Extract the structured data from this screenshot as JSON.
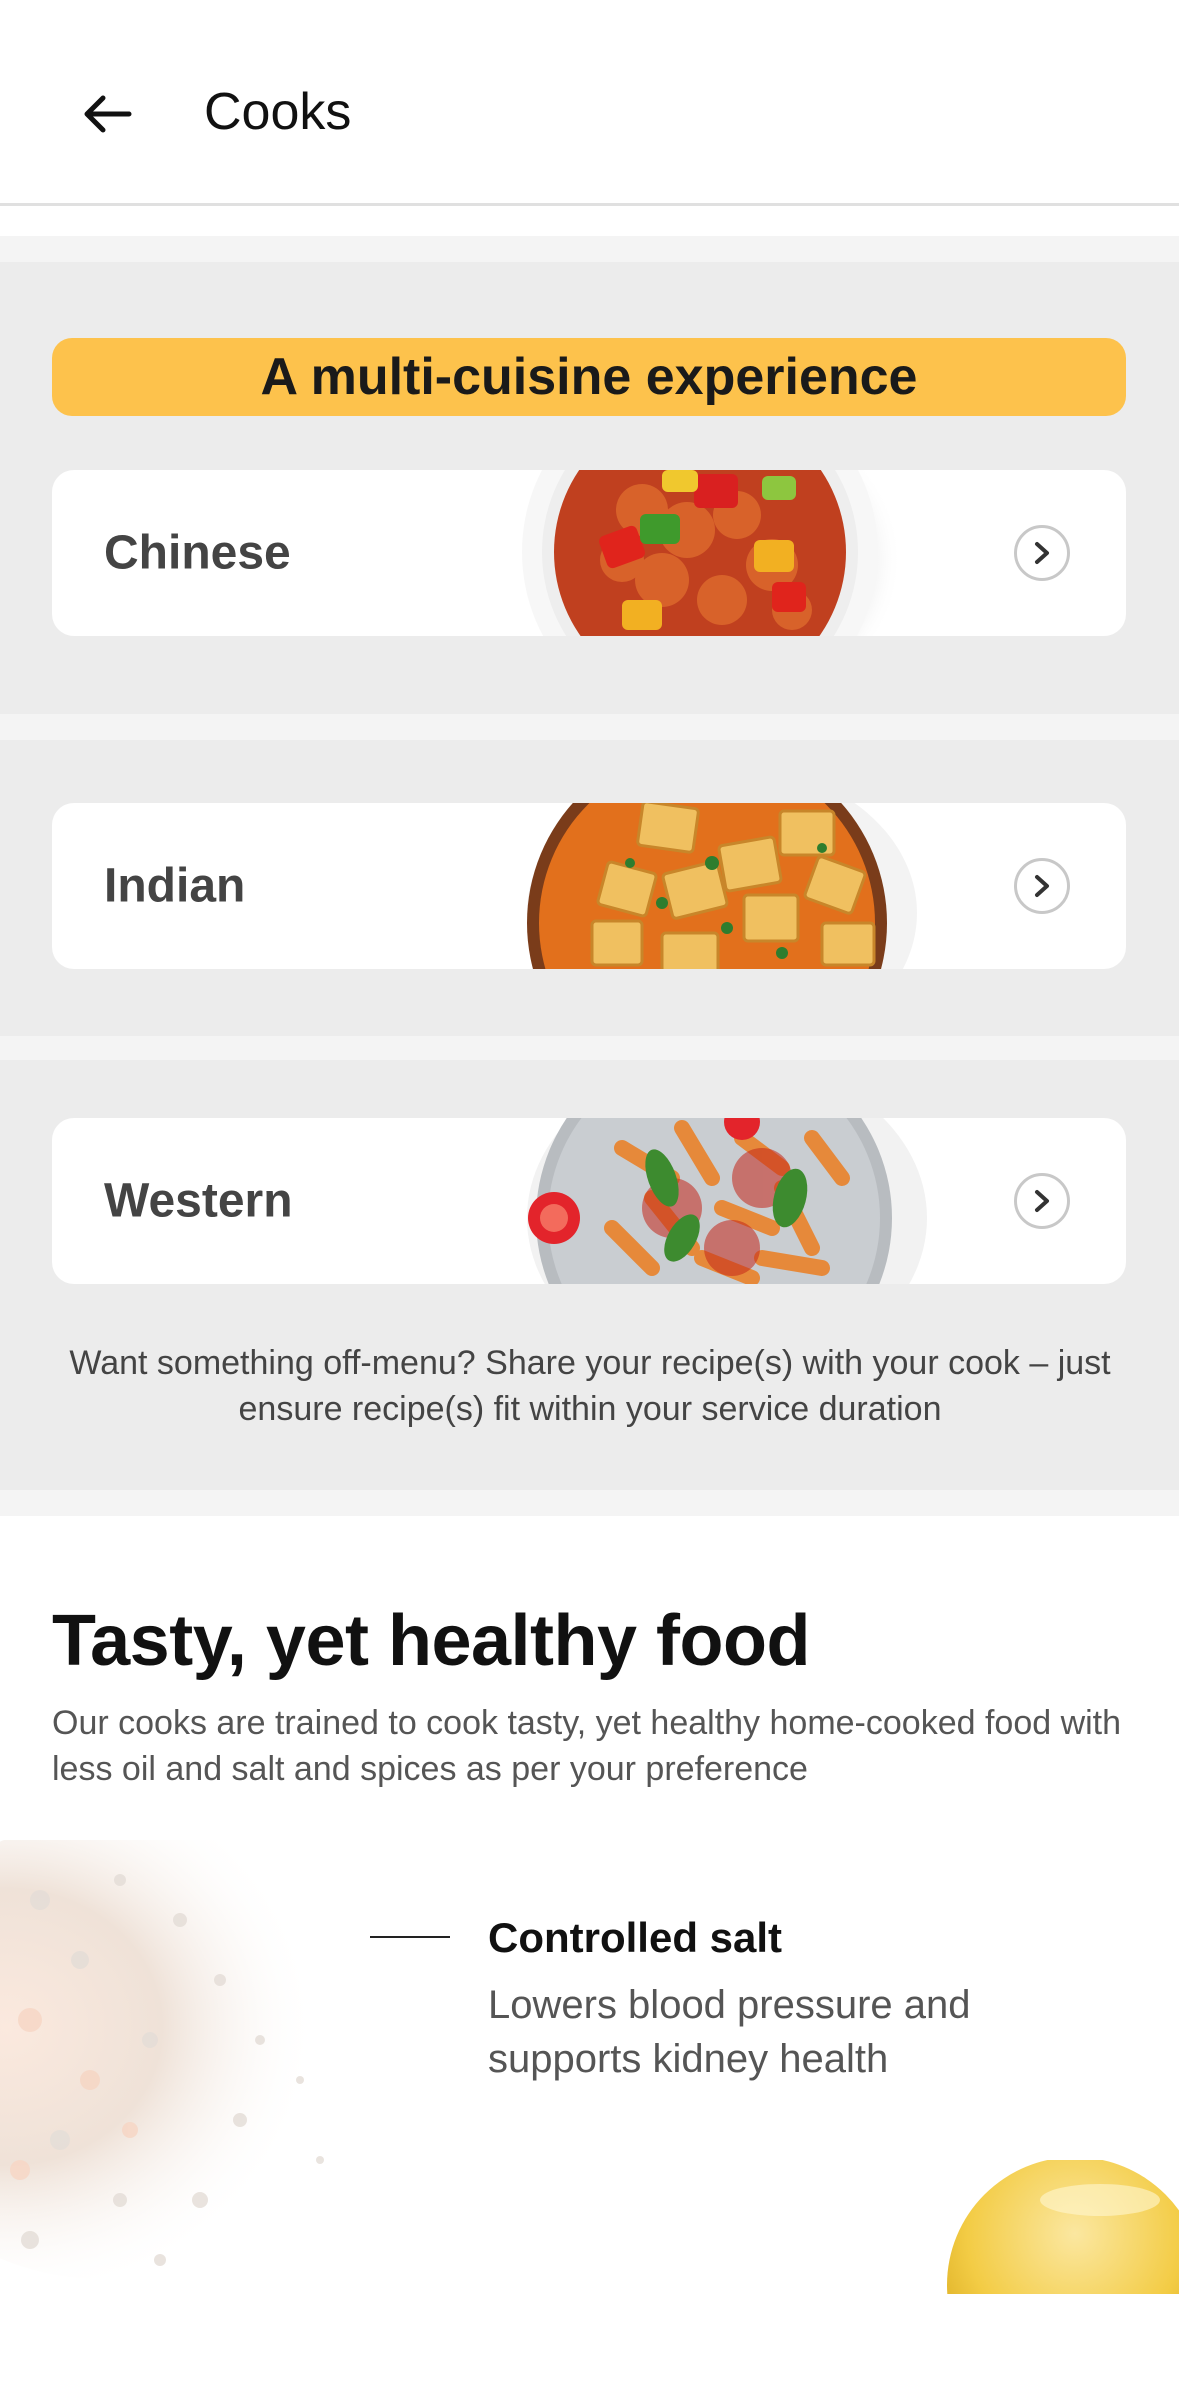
{
  "header": {
    "title": "Cooks",
    "back_icon": "arrow-left-icon"
  },
  "cuisine_section": {
    "banner": "A multi-cuisine experience",
    "cards": [
      {
        "label": "Chinese",
        "image": "sweet-and-sour-chicken-image"
      },
      {
        "label": "Indian",
        "image": "paneer-curry-image"
      },
      {
        "label": "Western",
        "image": "penne-pasta-image"
      }
    ],
    "note": "Want something off-menu? Share your recipe(s) with your cook – just ensure recipe(s) fit within your service duration"
  },
  "healthy_section": {
    "title": "Tasty, yet healthy food",
    "description": "Our cooks are trained to cook tasty, yet healthy home-cooked food with less oil and salt and spices as per your preference",
    "features": [
      {
        "title": "Controlled salt",
        "description": "Lowers blood pressure and supports kidney health",
        "image": "salt-image"
      }
    ]
  },
  "colors": {
    "accent": "#fdc24c",
    "section_bg": "#ececec",
    "text": "#111111"
  }
}
